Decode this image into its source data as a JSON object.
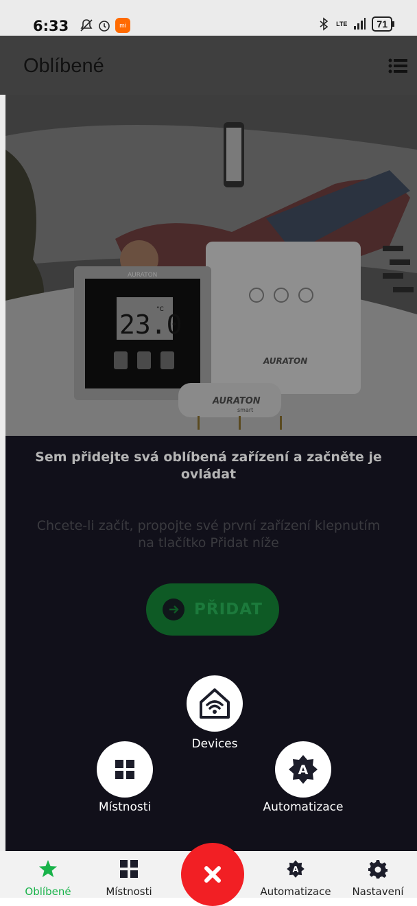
{
  "status_bar": {
    "time": "6:33",
    "lte": "LTE",
    "battery": "71",
    "icons": [
      "notifications-off-icon",
      "alarm-icon",
      "mi-app-icon",
      "bluetooth-icon",
      "signal-icon",
      "battery-icon"
    ]
  },
  "header": {
    "title": "Oblíbené",
    "menu_icon": "list-menu-icon"
  },
  "hero": {
    "thermostat_brand": "AURATON",
    "temperature": "23.0",
    "temperature_unit": "°C",
    "product_brand": "AURATON",
    "product_subbrand": "smart"
  },
  "empty_state": {
    "headline": "Sem přidejte svá oblíbená zařízení a začněte je ovládat",
    "subtext": "Chcete-li začít, propojte své první zařízení klepnutím na tlačítko Přidat níže",
    "add_button_label": "PŘIDAT"
  },
  "fab_menu": {
    "devices": "Devices",
    "rooms": "Místnosti",
    "automation": "Automatizace"
  },
  "bottom_nav": {
    "items": [
      {
        "label": "Oblíbené",
        "icon": "star-icon",
        "active": true
      },
      {
        "label": "Místnosti",
        "icon": "grid-icon",
        "active": false
      },
      {
        "label": "Automatizace",
        "icon": "automation-icon",
        "active": false
      },
      {
        "label": "Nastavení",
        "icon": "gear-icon",
        "active": false
      }
    ]
  },
  "colors": {
    "accent_green": "#19b34a",
    "close_red": "#f21f24",
    "overlay_dark": "#11101a"
  }
}
